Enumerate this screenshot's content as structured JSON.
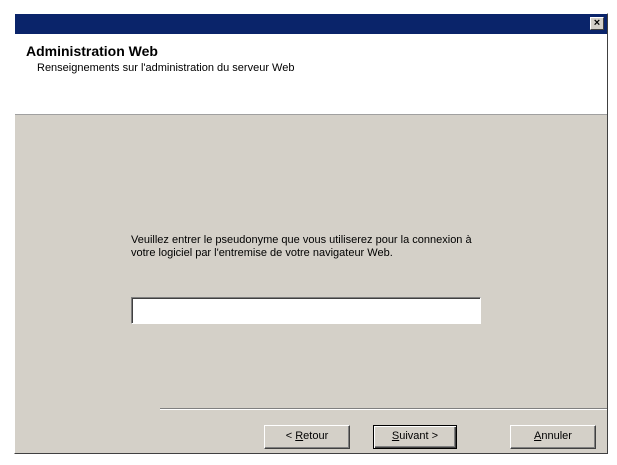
{
  "window": {
    "close_glyph": "×"
  },
  "header": {
    "title": "Administration Web",
    "subtitle": "Renseignements sur l'administration du serveur Web"
  },
  "main": {
    "prompt": "Veuillez entrer le pseudonyme que vous utiliserez pour la connexion à votre logiciel par l'entremise de votre navigateur Web.",
    "username_value": ""
  },
  "buttons": {
    "back_prefix": "< ",
    "back_mnemonic": "R",
    "back_rest": "etour",
    "next_mnemonic": "S",
    "next_rest": "uivant >",
    "cancel_mnemonic": "A",
    "cancel_rest": "nnuler"
  }
}
